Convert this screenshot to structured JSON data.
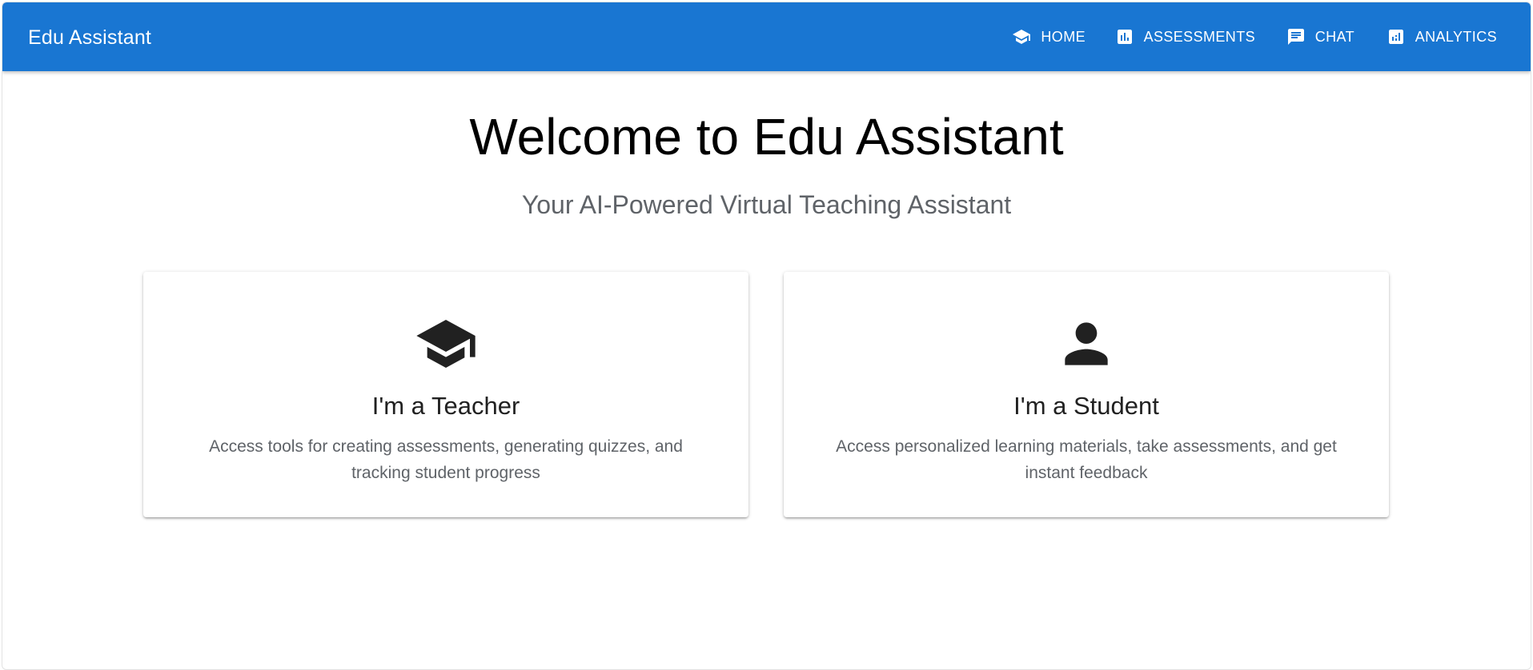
{
  "app": {
    "title": "Edu Assistant"
  },
  "nav": [
    {
      "label": "HOME",
      "icon": "graduation-cap-icon"
    },
    {
      "label": "ASSESSMENTS",
      "icon": "assessment-icon"
    },
    {
      "label": "CHAT",
      "icon": "chat-icon"
    },
    {
      "label": "ANALYTICS",
      "icon": "analytics-icon"
    }
  ],
  "hero": {
    "title": "Welcome to Edu Assistant",
    "subtitle": "Your AI-Powered Virtual Teaching Assistant"
  },
  "cards": [
    {
      "title": "I'm a Teacher",
      "description": "Access tools for creating assessments, generating quizzes, and tracking student progress",
      "icon": "graduation-cap-icon"
    },
    {
      "title": "I'm a Student",
      "description": "Access personalized learning materials, take assessments, and get instant feedback",
      "icon": "person-icon"
    }
  ],
  "colors": {
    "appbar": "#1976d2",
    "title_text": "#000000",
    "secondary_text": "#5f6368",
    "icon": "#212121"
  }
}
